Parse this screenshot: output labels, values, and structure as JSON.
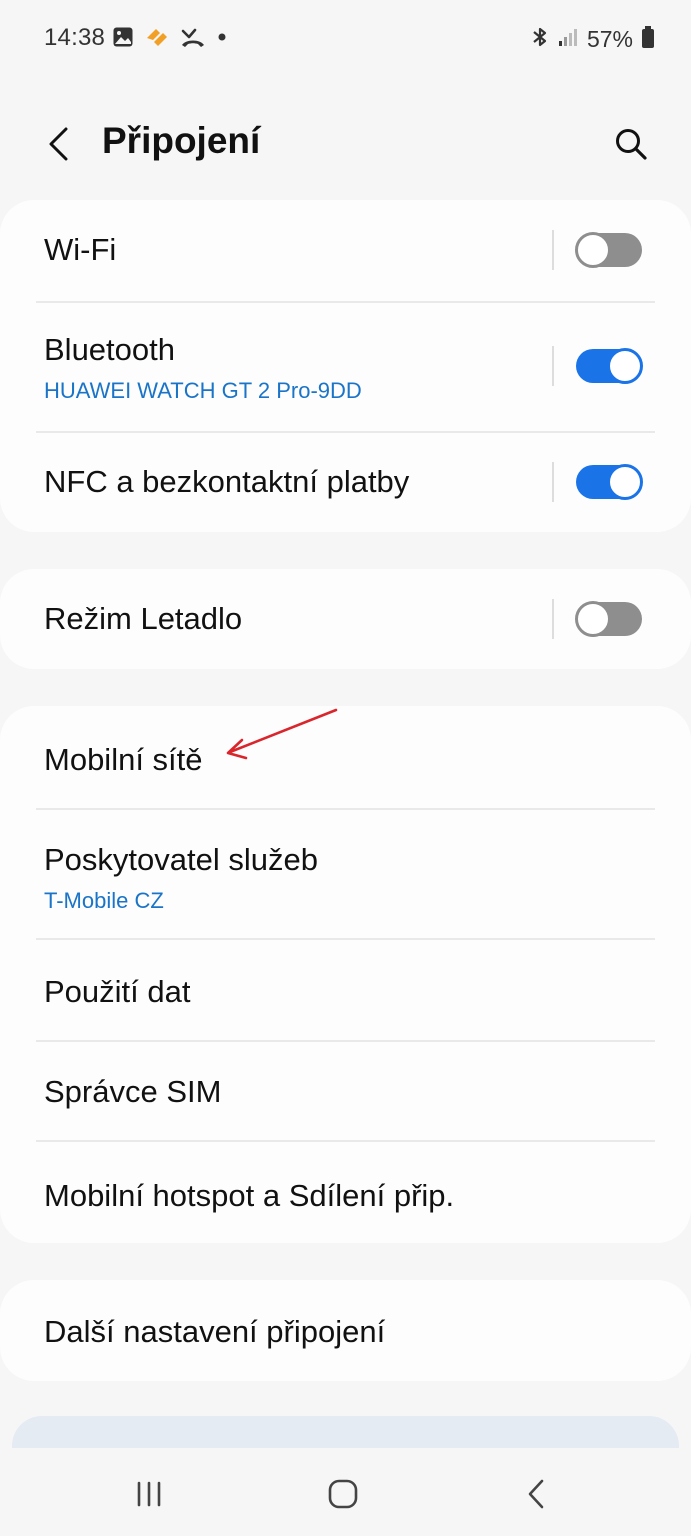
{
  "status_bar": {
    "time": "14:38",
    "left_icons": [
      "gallery-icon",
      "app-notification-icon",
      "missed-call-icon",
      "notification-dot-icon"
    ],
    "right_icons": [
      "bluetooth-icon",
      "signal-icon",
      "battery-icon"
    ],
    "battery": "57%"
  },
  "header": {
    "title": "Připojení",
    "back_icon": "chevron-left-icon",
    "search_icon": "search-icon"
  },
  "colors": {
    "accent": "#1a74e8",
    "subtitle": "#1a74c8",
    "toggle_off": "#8e8e8e",
    "annotation": "#d9262c"
  },
  "groups": {
    "wireless": {
      "wifi": {
        "title": "Wi-Fi",
        "toggle": "off"
      },
      "bluetooth": {
        "title": "Bluetooth",
        "subtitle": "HUAWEI WATCH GT 2 Pro-9DD",
        "toggle": "on"
      },
      "nfc": {
        "title": "NFC a bezkontaktní platby",
        "toggle": "on"
      }
    },
    "airplane": {
      "title": "Režim Letadlo",
      "toggle": "off"
    },
    "mobile": {
      "mobile_networks": {
        "title": "Mobilní sítě"
      },
      "provider": {
        "title": "Poskytovatel služeb",
        "subtitle": "T-Mobile CZ"
      },
      "data_usage": {
        "title": "Použití dat"
      },
      "sim_manager": {
        "title": "Správce SIM"
      },
      "hotspot": {
        "title": "Mobilní hotspot a Sdílení přip."
      }
    },
    "more": {
      "title": "Další nastavení připojení"
    }
  },
  "nav_bar": {
    "items": [
      "recents-icon",
      "home-icon",
      "back-icon"
    ]
  }
}
